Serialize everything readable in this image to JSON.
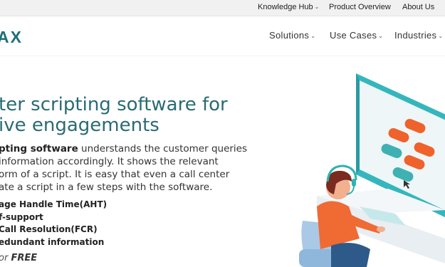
{
  "topbar": {
    "links": [
      {
        "label": "Knowledge Hub",
        "has_dropdown": true
      },
      {
        "label": "Product Overview",
        "has_dropdown": false
      },
      {
        "label": "About Us",
        "has_dropdown": false
      }
    ]
  },
  "header": {
    "logo_text": "AX",
    "nav": [
      {
        "label": "Solutions"
      },
      {
        "label": "Use Cases"
      },
      {
        "label": "Industries"
      }
    ]
  },
  "hero": {
    "headline_line1": "ter scripting software for",
    "headline_line2": "ive engagements",
    "para_bold": "pting software",
    "para_line1_rest": " understands the customer queries",
    "para_line2": " information accordingly. It shows the relevant",
    "para_line3": "orm of a script. It is easy that even a call center",
    "para_line4": "ate a script in a few steps with the software.",
    "benefits": [
      "age Handle Time(AHT)",
      "f-support",
      "Call Resolution(FCR)",
      "edundant information"
    ],
    "cta_prefix": "or ",
    "cta_bold": "FREE"
  },
  "colors": {
    "accent": "#2a6b73",
    "screen_frame": "#3bbfc4",
    "orange": "#f0622b",
    "teal": "#3fb1b2",
    "agent_shirt": "#f06a33"
  }
}
